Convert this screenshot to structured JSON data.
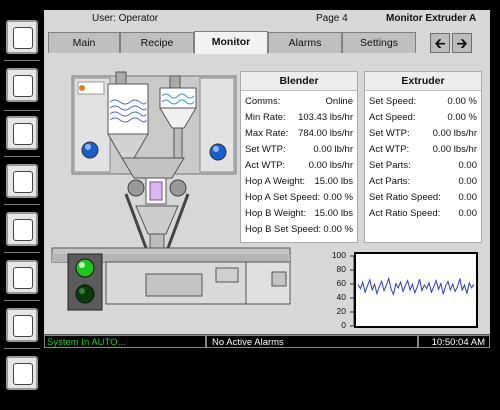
{
  "header": {
    "user_label": "User: Operator",
    "page_label": "Page 4",
    "screen_title": "Monitor Extruder A"
  },
  "tabs": [
    {
      "label": "Main"
    },
    {
      "label": "Recipe"
    },
    {
      "label": "Monitor"
    },
    {
      "label": "Alarms"
    },
    {
      "label": "Settings"
    }
  ],
  "nav": {
    "back_icon": "arrow-left-icon",
    "forward_icon": "arrow-right-icon"
  },
  "blender": {
    "title": "Blender",
    "rows": [
      {
        "label": "Comms:",
        "value": "Online"
      },
      {
        "label": "Min Rate:",
        "value": "103.43 lbs/hr"
      },
      {
        "label": "Max Rate:",
        "value": "784.00 lbs/hr"
      },
      {
        "label": "Set WTP:",
        "value": "0.00 lb/hr"
      },
      {
        "label": "Act WTP:",
        "value": "0.00 lbs/hr"
      },
      {
        "label": "Hop A Weight:",
        "value": "15.00 lbs"
      },
      {
        "label": "Hop A Set Speed:",
        "value": "0.00 %"
      },
      {
        "label": "Hop B Weight:",
        "value": "15.00 lbs"
      },
      {
        "label": "Hop B Set Speed:",
        "value": "0.00 %"
      }
    ]
  },
  "extruder": {
    "title": "Extruder",
    "rows": [
      {
        "label": "Set Speed:",
        "value": "0.00 %"
      },
      {
        "label": "Act Speed:",
        "value": "0.00 %"
      },
      {
        "label": "Set WTP:",
        "value": "0.00 lbs/hr"
      },
      {
        "label": "Act WTP:",
        "value": "0.00 lbs/hr"
      },
      {
        "label": "Set Parts:",
        "value": "0.00"
      },
      {
        "label": "Act Parts:",
        "value": "0.00"
      },
      {
        "label": "Set Ratio Speed:",
        "value": "0.00"
      },
      {
        "label": "Act Ratio Speed:",
        "value": "0.00"
      }
    ]
  },
  "trend": {
    "y_ticks": [
      "100",
      "80",
      "60",
      "40",
      "20",
      "0"
    ],
    "values": [
      58,
      52,
      61,
      47,
      56,
      64,
      50,
      58,
      45,
      55,
      62,
      49,
      57,
      66,
      51,
      44,
      59,
      53,
      61,
      48,
      56,
      63,
      50,
      58,
      46,
      54,
      65,
      49,
      57,
      52,
      60,
      47,
      55,
      63,
      51,
      59,
      44,
      56,
      62,
      50,
      58,
      48,
      54,
      66,
      50,
      57,
      45,
      60,
      53,
      58
    ]
  },
  "colors": {
    "trend_line": "#2a3cc2",
    "indicator_green": "#1fc41f",
    "status_auto": "#19d119"
  },
  "status": {
    "mode_text": "System In AUTO...",
    "alarm_text": "No Active Alarms",
    "time_text": "10:50:04 AM"
  }
}
